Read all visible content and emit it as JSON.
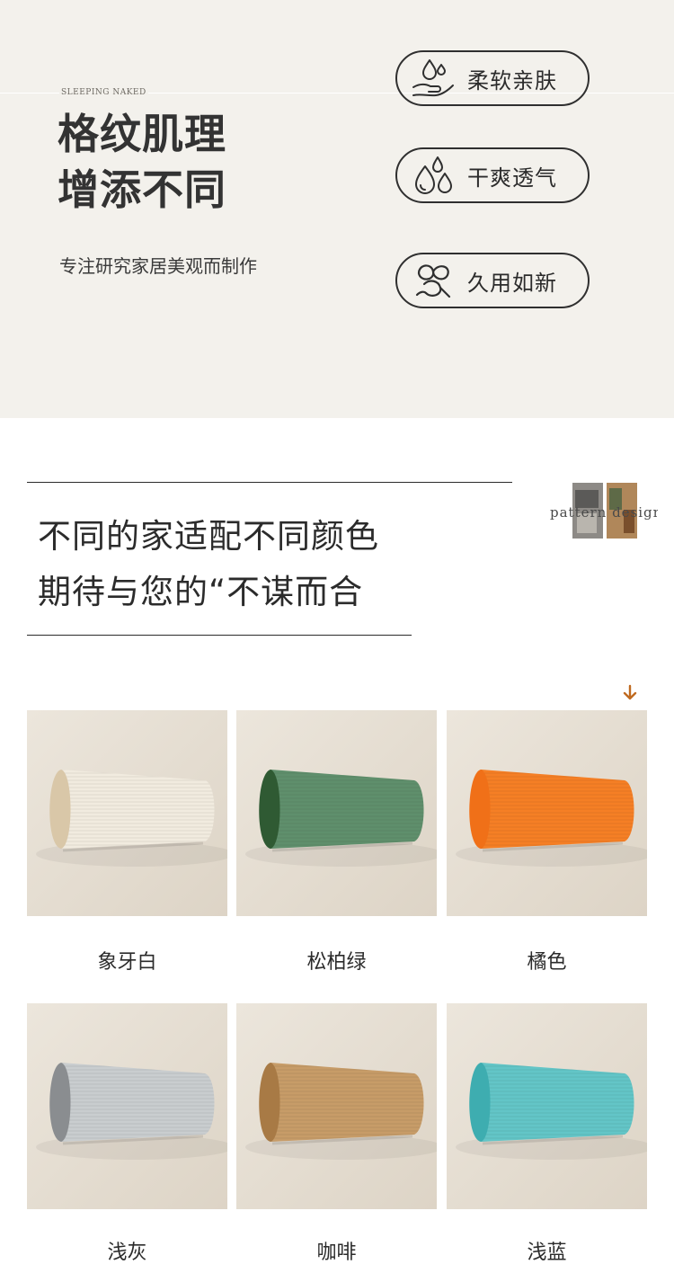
{
  "hero": {
    "brand": "SLEEPING NAKED",
    "title_line1": "格纹肌理",
    "title_line2": "增添不同",
    "subtitle": "专注研究家居美观而制作",
    "features": [
      {
        "label": "柔软亲肤",
        "icon": "water-hand-icon"
      },
      {
        "label": "干爽透气",
        "icon": "water-drops-icon"
      },
      {
        "label": "久用如新",
        "icon": "leaf-knot-icon"
      }
    ]
  },
  "section": {
    "title_line1": "不同的家适配不同颜色",
    "title_line2": "期待与您的“不谋而合",
    "badge_text": "pattern design"
  },
  "colors": {
    "products": [
      {
        "name": "象牙白",
        "fabric": "#f1ebdf",
        "end": "#d9c7a8"
      },
      {
        "name": "松柏绿",
        "fabric": "#5f8f6c",
        "end": "#2f5a33"
      },
      {
        "name": "橘色",
        "fabric": "#f57f25",
        "end": "#f07018"
      },
      {
        "name": "浅灰",
        "fabric": "#c9cdcf",
        "end": "#8a8d90"
      },
      {
        "name": "咖啡",
        "fabric": "#c79c68",
        "end": "#a87a45"
      },
      {
        "name": "浅蓝",
        "fabric": "#63c5c7",
        "end": "#3eadb0"
      }
    ]
  }
}
